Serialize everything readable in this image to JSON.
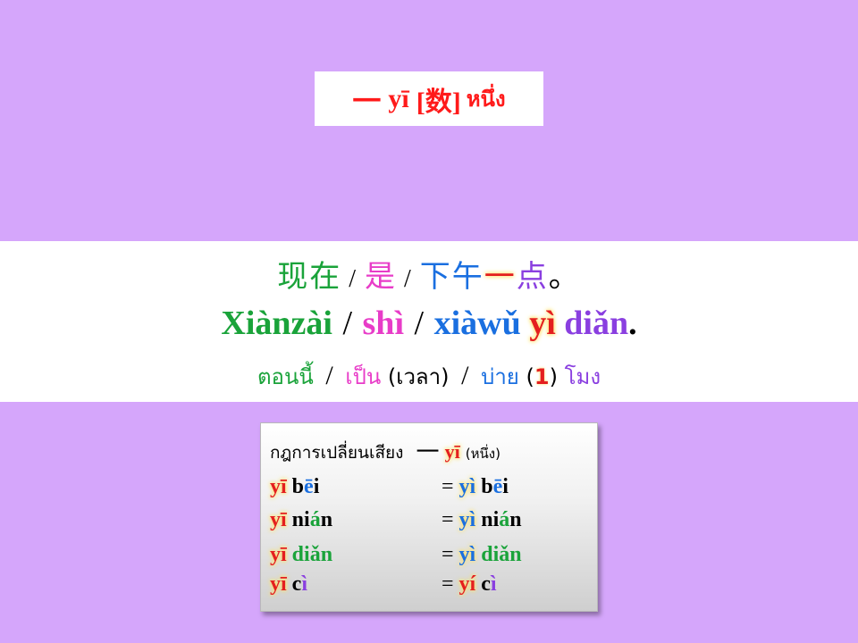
{
  "title": {
    "hanzi": "一",
    "pinyin": "yī",
    "category": "[数]",
    "thai": "หนึ่ง"
  },
  "sentence": {
    "hanzi": {
      "part1": "现在",
      "sep1": "/",
      "part2": "是",
      "sep2": "/",
      "part3": "下午",
      "part4": "一",
      "part5": "点",
      "end": "。"
    },
    "pinyin": {
      "part1": "Xiànzài",
      "sep1": "/",
      "part2": "shì",
      "sep2": "/",
      "part3": "xiàwǔ",
      "part4": "yì",
      "part5": "diǎn",
      "end": "."
    },
    "thai": {
      "part1": "ตอนนี้",
      "sep1": "/",
      "part2": "เป็น",
      "paren1": "(เวลา)",
      "sep2": "/",
      "part3": "บ่าย",
      "paren_open": "(",
      "num": "1",
      "paren_close": ")",
      "part4": "โมง"
    }
  },
  "rule": {
    "heading": "กฎการเปลี่ยนเสียง",
    "hanzi": "一",
    "pinyin": "yī",
    "meaning": "(หนึ่ง)",
    "rows": [
      {
        "left_yi": "yī",
        "left_rest": "bēi",
        "eq": "=",
        "right_yi": "yì",
        "right_rest": "bēi"
      },
      {
        "left_yi": "yī",
        "left_rest": "nián",
        "eq": "=",
        "right_yi": "yì",
        "right_rest": "nián"
      },
      {
        "left_yi": "yī",
        "left_rest": "diǎn",
        "eq": "=",
        "right_yi": "yì",
        "right_rest": "diǎn"
      },
      {
        "left_yi": "yī",
        "left_rest": "cì",
        "eq": "=",
        "right_yi": "yí",
        "right_rest": "cì"
      }
    ]
  },
  "colors": {
    "background": "#d5a6fb",
    "green": "#1aa33a",
    "pink": "#e83cc8",
    "blue": "#1a6fe0",
    "red": "#e41f1f",
    "purple": "#8a3fe0"
  }
}
